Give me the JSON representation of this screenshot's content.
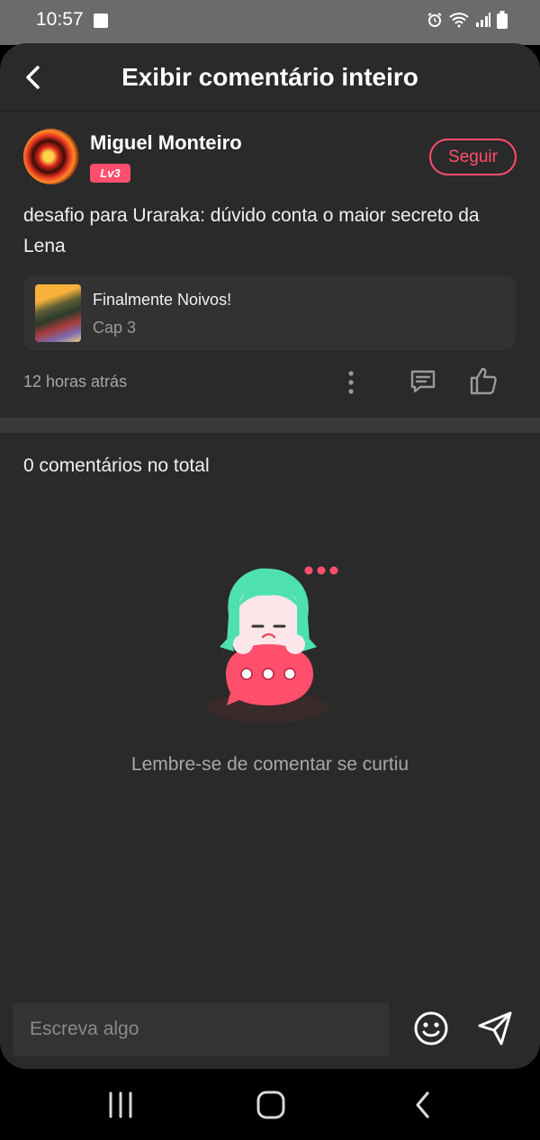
{
  "status_bar": {
    "time": "10:57",
    "icons": [
      "image-icon",
      "alarm-icon",
      "wifi-icon",
      "signal-icon",
      "battery-icon"
    ]
  },
  "header": {
    "title": "Exibir comentário inteiro",
    "back_icon": "chevron-left-icon"
  },
  "comment": {
    "author": "Miguel Monteiro",
    "level": "Lv3",
    "follow_label": "Seguir",
    "text": "desafio para Uraraka: dúvido conta o maior secreto da Lena",
    "manga": {
      "title": "Finalmente Noivos!",
      "chapter": "Cap 3"
    },
    "timestamp": "12 horas atrás",
    "action_icons": [
      "more-vertical-icon",
      "comment-icon",
      "thumbs-up-icon"
    ]
  },
  "replies": {
    "total_label": "0 comentários no total",
    "empty_message": "Lembre-se de comentar se curtiu"
  },
  "input": {
    "placeholder": "Escreva algo",
    "emoji_icon": "smiley-icon",
    "send_icon": "send-icon"
  },
  "nav_bar": {
    "icons": [
      "recent-apps-icon",
      "home-icon",
      "back-icon"
    ]
  },
  "colors": {
    "accent": "#ff4f6d",
    "background": "#2a2a2a",
    "mascot_hair": "#4fe0b2"
  }
}
